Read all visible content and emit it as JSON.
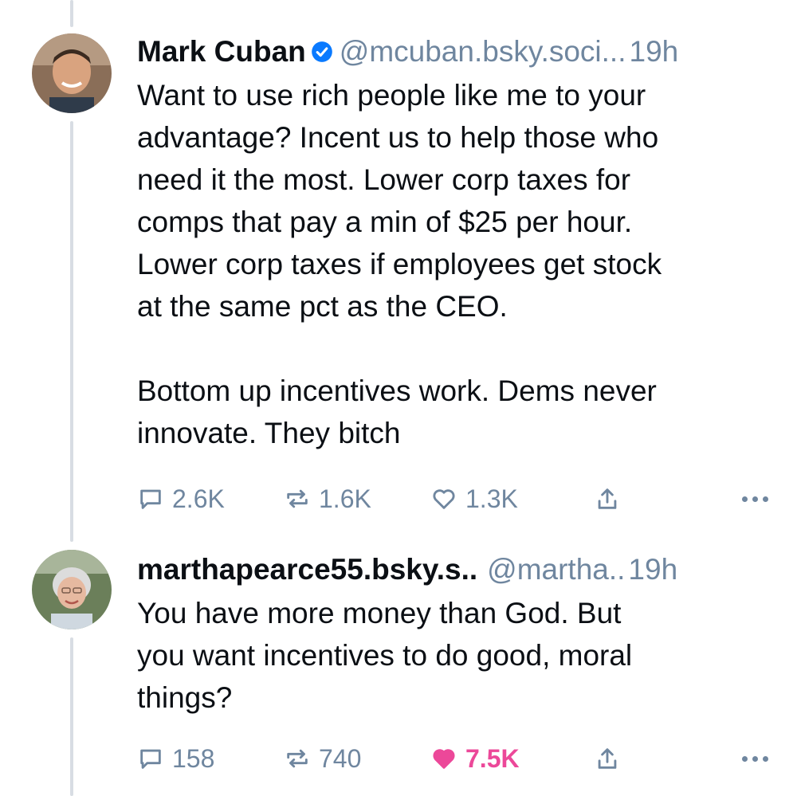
{
  "colors": {
    "muted": "#6f869f",
    "verified": "#0a7aff",
    "like": "#ec4899",
    "thread_line": "#d8dde3"
  },
  "posts": [
    {
      "author": "Mark Cuban",
      "verified": true,
      "handle": "@mcuban.bsky.soci...",
      "time": "19h",
      "text": "Want to use rich people like me to your\nadvantage? Incent us to help those who\nneed it the most.  Lower corp taxes for\ncomps that pay a min of $25 per hour.\nLower corp taxes if employees get stock\nat the same pct as the CEO.\n\nBottom up incentives work. Dems never\ninnovate. They bitch",
      "replies": "2.6K",
      "reposts": "1.6K",
      "likes": "1.3K",
      "liked": false,
      "icons": [
        "reply-icon",
        "repost-icon",
        "like-icon",
        "share-icon",
        "more-icon"
      ]
    },
    {
      "author": "marthapearce55.bsky.s..",
      "verified": false,
      "handle": "@martha..",
      "time": "19h",
      "text": "You have more money than God. But\nyou want incentives to do good, moral\nthings?",
      "replies": "158",
      "reposts": "740",
      "likes": "7.5K",
      "liked": true,
      "icons": [
        "reply-icon",
        "repost-icon",
        "like-icon",
        "share-icon",
        "more-icon"
      ]
    }
  ]
}
